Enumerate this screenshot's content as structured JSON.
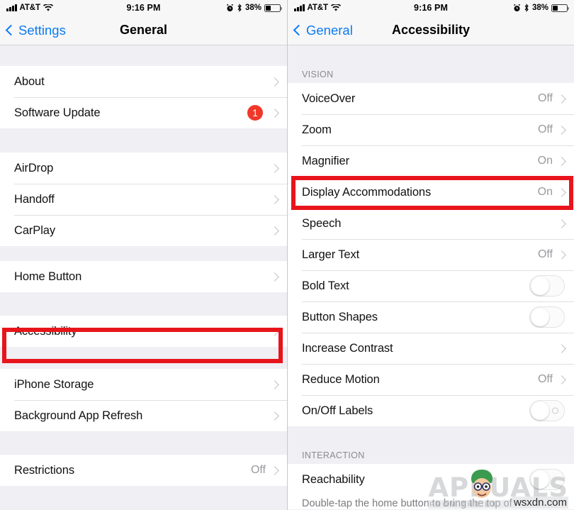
{
  "status_bar": {
    "carrier": "AT&T",
    "time": "9:16 PM",
    "battery_percent": "38%",
    "signal_icon": "signal-bars-icon",
    "wifi_icon": "wifi-icon",
    "alarm_icon": "alarm-clock-icon",
    "bluetooth_icon": "bluetooth-icon",
    "battery_icon": "battery-icon"
  },
  "left_screen": {
    "nav": {
      "back_label": "Settings",
      "title": "General"
    },
    "groups": [
      {
        "rows": [
          {
            "label": "About",
            "value": "",
            "type": "chevron"
          },
          {
            "label": "Software Update",
            "value": "",
            "type": "chevron",
            "badge": "1"
          }
        ]
      },
      {
        "rows": [
          {
            "label": "AirDrop",
            "value": "",
            "type": "chevron"
          },
          {
            "label": "Handoff",
            "value": "",
            "type": "chevron"
          },
          {
            "label": "CarPlay",
            "value": "",
            "type": "chevron"
          }
        ]
      },
      {
        "rows": [
          {
            "label": "Home Button",
            "value": "",
            "type": "chevron"
          }
        ]
      },
      {
        "rows": [
          {
            "label": "Accessibility",
            "value": "",
            "type": "chevron",
            "highlighted": true
          }
        ]
      },
      {
        "rows": [
          {
            "label": "iPhone Storage",
            "value": "",
            "type": "chevron"
          },
          {
            "label": "Background App Refresh",
            "value": "",
            "type": "chevron"
          }
        ]
      },
      {
        "rows": [
          {
            "label": "Restrictions",
            "value": "Off",
            "type": "chevron"
          }
        ]
      }
    ]
  },
  "right_screen": {
    "nav": {
      "back_label": "General",
      "title": "Accessibility"
    },
    "sections": [
      {
        "header": "VISION",
        "rows": [
          {
            "label": "VoiceOver",
            "value": "Off",
            "type": "chevron"
          },
          {
            "label": "Zoom",
            "value": "Off",
            "type": "chevron"
          },
          {
            "label": "Magnifier",
            "value": "On",
            "type": "chevron"
          },
          {
            "label": "Display Accommodations",
            "value": "On",
            "type": "chevron",
            "highlighted": true
          },
          {
            "label": "Speech",
            "value": "",
            "type": "chevron"
          },
          {
            "label": "Larger Text",
            "value": "Off",
            "type": "chevron"
          },
          {
            "label": "Bold Text",
            "value": "",
            "type": "toggle",
            "toggle_on": false
          },
          {
            "label": "Button Shapes",
            "value": "",
            "type": "toggle",
            "toggle_on": false
          },
          {
            "label": "Increase Contrast",
            "value": "",
            "type": "chevron"
          },
          {
            "label": "Reduce Motion",
            "value": "Off",
            "type": "chevron"
          },
          {
            "label": "On/Off Labels",
            "value": "",
            "type": "toggle-labels",
            "toggle_on": false
          }
        ]
      },
      {
        "header": "INTERACTION",
        "rows": [
          {
            "label": "Reachability",
            "value": "",
            "type": "toggle-partial"
          }
        ],
        "footnote": "Double-tap the home button to bring the top of the screen"
      }
    ]
  },
  "watermark": {
    "brand": "APPUALS",
    "tagline": "FROM THE EX",
    "site": "wsxdn.com"
  },
  "colors": {
    "accent_blue": "#0b7bf1",
    "badge_red": "#f03829",
    "highlight_red": "#e8141b",
    "group_bg": "#efeff4"
  }
}
